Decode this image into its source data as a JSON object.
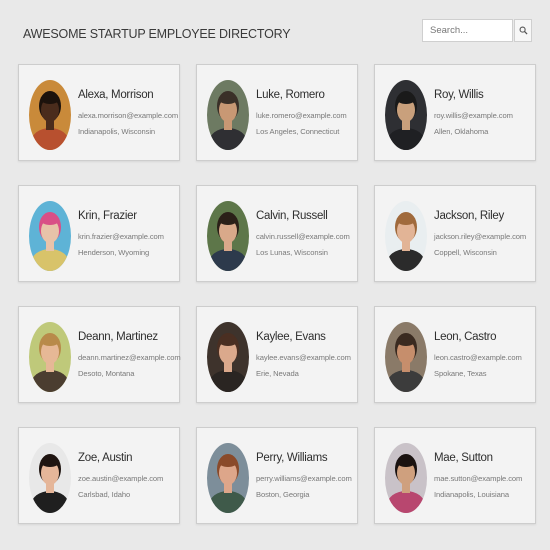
{
  "header": {
    "title": "AWESOME STARTUP EMPLOYEE DIRECTORY"
  },
  "search": {
    "placeholder": "Search...",
    "button_icon": "search-icon"
  },
  "employees": [
    {
      "name": "Alexa, Morrison",
      "email": "alexa.morrison@example.com",
      "location": "Indianapolis, Wisconsin",
      "photo": {
        "bg": "#c98a3a",
        "skin": "#4a2c1c",
        "hair": "#1c120c",
        "shirt": "#b8502f"
      }
    },
    {
      "name": "Luke, Romero",
      "email": "luke.romero@example.com",
      "location": "Los Angeles, Connecticut",
      "photo": {
        "bg": "#6d7a62",
        "skin": "#c89874",
        "hair": "#3a3028",
        "shirt": "#2f2f33"
      }
    },
    {
      "name": "Roy, Willis",
      "email": "roy.willis@example.com",
      "location": "Allen, Oklahoma",
      "photo": {
        "bg": "#2e2f33",
        "skin": "#c9a07c",
        "hair": "#1a1a1a",
        "shirt": "#1f2023"
      }
    },
    {
      "name": "Krin, Frazier",
      "email": "krin.frazier@example.com",
      "location": "Henderson, Wyoming",
      "photo": {
        "bg": "#5eb3d6",
        "skin": "#e8c3a9",
        "hair": "#d94f86",
        "shirt": "#d8c36a"
      }
    },
    {
      "name": "Calvin, Russell",
      "email": "calvin.russell@example.com",
      "location": "Los Lunas, Wisconsin",
      "photo": {
        "bg": "#5d7649",
        "skin": "#d9a98a",
        "hair": "#2b2018",
        "shirt": "#2d3a4c"
      }
    },
    {
      "name": "Jackson, Riley",
      "email": "jackson.riley@example.com",
      "location": "Coppell, Wisconsin",
      "photo": {
        "bg": "#e9eef0",
        "skin": "#e2b496",
        "hair": "#a06a3c",
        "shirt": "#2b2b2b"
      }
    },
    {
      "name": "Deann, Martinez",
      "email": "deann.martinez@example.com",
      "location": "Desoto, Montana",
      "photo": {
        "bg": "#bfc97a",
        "skin": "#e6b896",
        "hair": "#b88a4a",
        "shirt": "#4b3d30"
      }
    },
    {
      "name": "Kaylee, Evans",
      "email": "kaylee.evans@example.com",
      "location": "Erie, Nevada",
      "photo": {
        "bg": "#3e332c",
        "skin": "#dba98c",
        "hair": "#4a2f22",
        "shirt": "#2a2522"
      }
    },
    {
      "name": "Leon, Castro",
      "email": "leon.castro@example.com",
      "location": "Spokane, Texas",
      "photo": {
        "bg": "#8a7a68",
        "skin": "#c68e6c",
        "hair": "#3a2a20",
        "shirt": "#3c3c3c"
      }
    },
    {
      "name": "Zoe, Austin",
      "email": "zoe.austin@example.com",
      "location": "Carlsbad, Idaho",
      "photo": {
        "bg": "#e8e8e8",
        "skin": "#e5b699",
        "hair": "#1e1410",
        "shirt": "#1f1f1f"
      }
    },
    {
      "name": "Perry, Williams",
      "email": "perry.williams@example.com",
      "location": "Boston, Georgia",
      "photo": {
        "bg": "#7d8e9a",
        "skin": "#dda68a",
        "hair": "#8a4a2a",
        "shirt": "#3f5a4a"
      }
    },
    {
      "name": "Mae, Sutton",
      "email": "mae.sutton@example.com",
      "location": "Indianapolis, Louisiana",
      "photo": {
        "bg": "#c9c2c8",
        "skin": "#cfa07e",
        "hair": "#1a1210",
        "shirt": "#b8476f"
      }
    }
  ]
}
